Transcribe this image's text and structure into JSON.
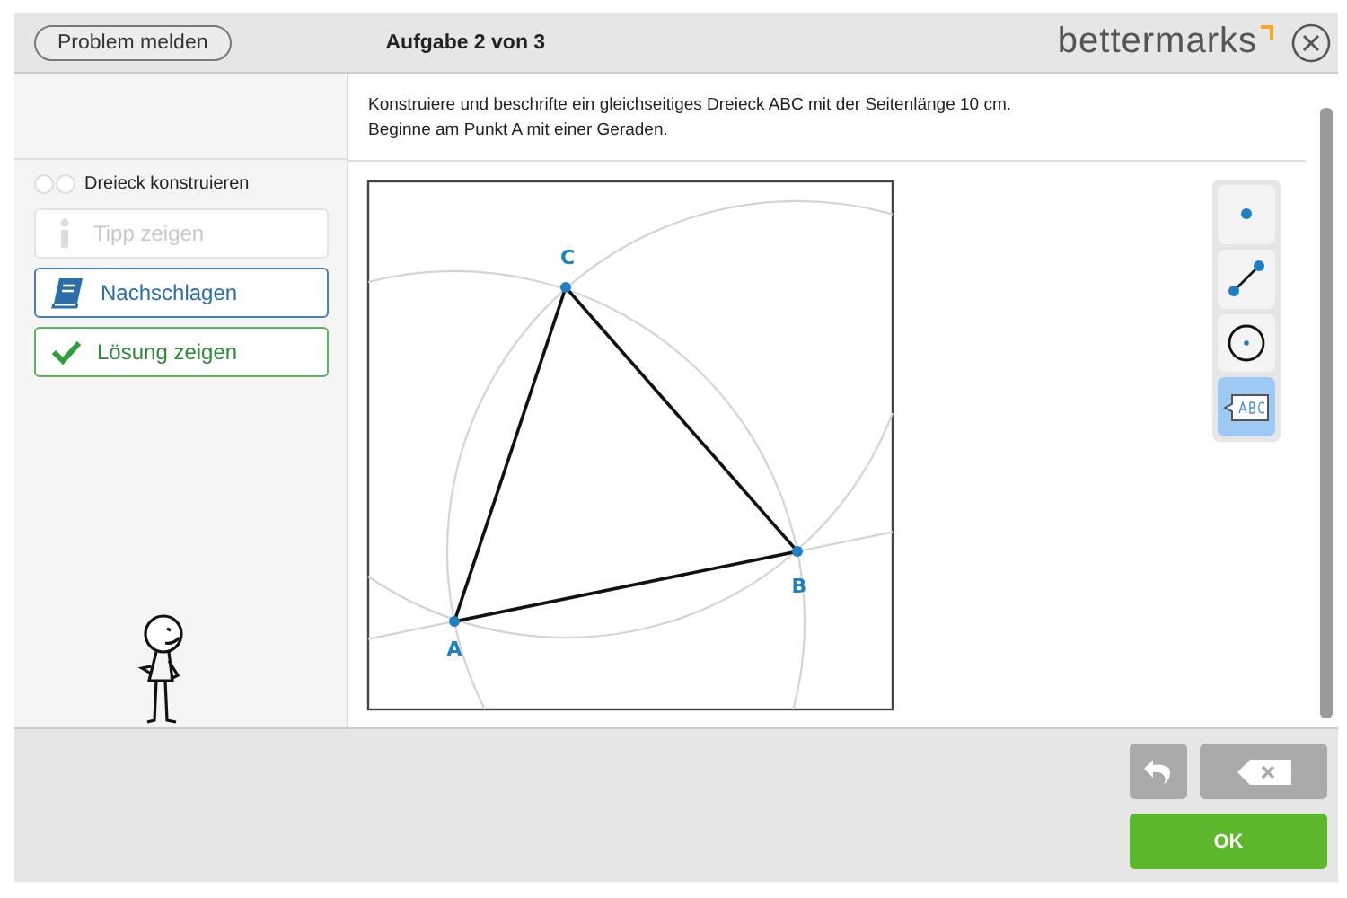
{
  "header": {
    "report_button": "Problem melden",
    "title": "Aufgabe 2 von 3",
    "logo": "bettermarks"
  },
  "task": {
    "lines": [
      "Konstruiere und beschrifte ein gleichseitiges Dreieck ABC mit der Seitenlänge 10 cm.",
      "Beginne am Punkt A mit einer Geraden."
    ]
  },
  "step": {
    "label": "Dreieck konstruieren"
  },
  "help_buttons": [
    {
      "kind": "hint",
      "label": "Tipp zeigen",
      "disabled": true
    },
    {
      "kind": "reference",
      "label": "Nachschlagen",
      "disabled": false
    },
    {
      "kind": "solution",
      "label": "Lösung zeigen",
      "disabled": false
    }
  ],
  "construction": {
    "points": [
      {
        "label": "A"
      },
      {
        "label": "B"
      },
      {
        "label": "C"
      }
    ]
  },
  "tools": [
    {
      "kind": "point",
      "selected": false
    },
    {
      "kind": "segment",
      "selected": false
    },
    {
      "kind": "circle",
      "selected": false
    },
    {
      "kind": "label",
      "selected": true
    }
  ],
  "actions": {
    "ok": "OK"
  }
}
